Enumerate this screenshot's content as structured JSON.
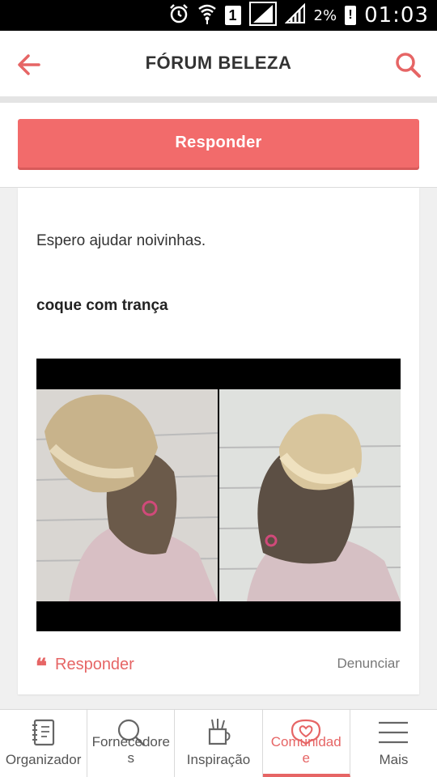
{
  "status_bar": {
    "sim_slot": "1",
    "battery_percent": "2%",
    "battery_alert": "!",
    "time": "01:03"
  },
  "app_bar": {
    "title": "FÓRUM BELEZA",
    "back_icon": "arrow-left-icon",
    "search_icon": "search-icon"
  },
  "reply_button_label": "Responder",
  "post": {
    "text_1": "Espero ajudar noivinhas.",
    "text_2": "coque com trança",
    "reply_label": "Responder",
    "report_label": "Denunciar",
    "quote_icon": "❝"
  },
  "tabs": [
    {
      "label": "Organizador",
      "icon": "notebook-icon"
    },
    {
      "label": "Fornecedore\ns",
      "icon": "search-icon"
    },
    {
      "label": "Inspiração",
      "icon": "pencil-cup-icon"
    },
    {
      "label": "Comunidad\ne",
      "icon": "heart-bubble-icon"
    },
    {
      "label": "Mais",
      "icon": "menu-icon"
    }
  ],
  "colors": {
    "accent": "#e66565",
    "button": "#f26b6b"
  }
}
